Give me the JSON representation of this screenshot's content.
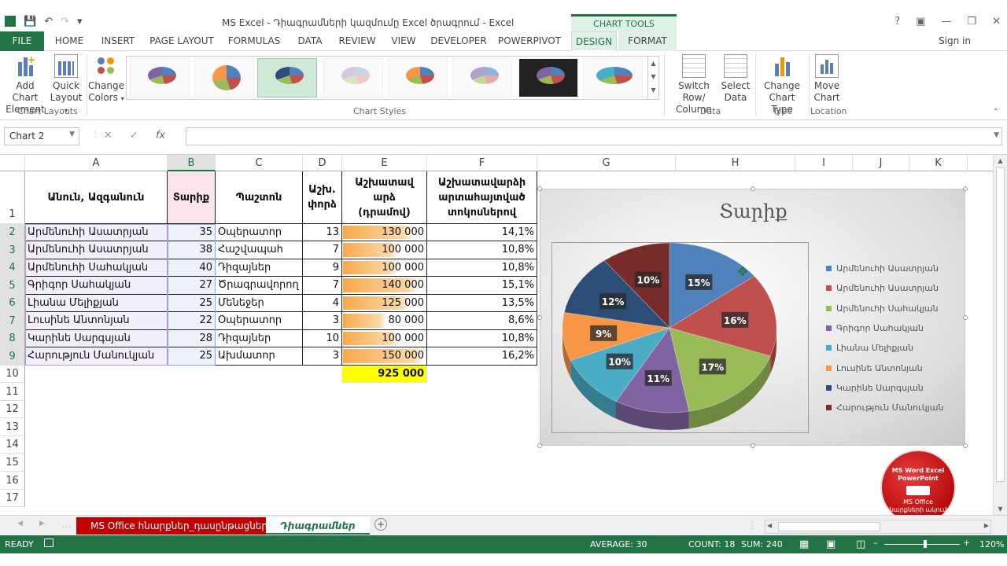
{
  "window": {
    "title": "MS Excel - Դիագրամների կազմումը Excel ծրագրում - Excel",
    "context_group": "CHART TOOLS"
  },
  "tabs": [
    "FILE",
    "HOME",
    "INSERT",
    "PAGE LAYOUT",
    "FORMULAS",
    "DATA",
    "REVIEW",
    "VIEW",
    "DEVELOPER",
    "POWERPIVOT",
    "DESIGN",
    "FORMAT"
  ],
  "signin": "Sign in",
  "ribbon": {
    "add_chart_element": "Add Chart",
    "add_chart_element2": "Element",
    "quick_layout": "Quick",
    "quick_layout2": "Layout",
    "change_colors": "Change",
    "change_colors2": "Colors",
    "chart_layouts_label": "Chart Layouts",
    "chart_styles_label": "Chart Styles",
    "switch_row_col": "Switch Row/",
    "switch_row_col2": "Column",
    "select_data": "Select",
    "select_data2": "Data",
    "data_label": "Data",
    "change_chart_type": "Change",
    "change_chart_type2": "Chart Type",
    "type_label": "Type",
    "move_chart": "Move",
    "move_chart2": "Chart",
    "location_label": "Location"
  },
  "namebox": "Chart 2",
  "formula": "",
  "columns": [
    "A",
    "B",
    "C",
    "D",
    "E",
    "F",
    "G",
    "H",
    "I",
    "J",
    "K"
  ],
  "rows": [
    "1",
    "2",
    "3",
    "4",
    "5",
    "6",
    "7",
    "8",
    "9",
    "10",
    "11",
    "12",
    "13",
    "14",
    "15",
    "16",
    "17"
  ],
  "table": {
    "headers": {
      "name": "Անուն, Ազգանուն",
      "age": "Տարիք",
      "position": "Պաշտոն",
      "exp1": "Աշխ.",
      "exp2": "փորձ",
      "salary1": "Աշխատավ",
      "salary2": "արձ",
      "salary3": "(դրամով)",
      "pct1": "Աշխատավարձի",
      "pct2": "արտահայտված",
      "pct3": "տոկոսներով"
    },
    "rows": [
      {
        "name": "Արմենուհի Ասատրյան",
        "age": "35",
        "position": "Օպերատոր",
        "exp": "13",
        "salary": "130 000",
        "pct": "14,1%",
        "fill": 0.87
      },
      {
        "name": "Արմենուհի Ասատրյան",
        "age": "38",
        "position": "Հաշվապահ",
        "exp": "7",
        "salary": "100 000",
        "pct": "10,8%",
        "fill": 0.67
      },
      {
        "name": "Արմենուհի Սահակյան",
        "age": "40",
        "position": "Դիզայներ",
        "exp": "9",
        "salary": "100 000",
        "pct": "10,8%",
        "fill": 0.67
      },
      {
        "name": "Գրիգոր Սահակյան",
        "age": "27",
        "position": "Ծրագրավորող",
        "exp": "7",
        "salary": "140 000",
        "pct": "15,1%",
        "fill": 0.93
      },
      {
        "name": "Լիանա Մելիքյան",
        "age": "25",
        "position": "Մենեջեր",
        "exp": "4",
        "salary": "125 000",
        "pct": "13,5%",
        "fill": 0.83
      },
      {
        "name": "Լուսինե Անտոնյան",
        "age": "22",
        "position": "Օպերատոր",
        "exp": "3",
        "salary": "80 000",
        "pct": "8,6%",
        "fill": 0.53
      },
      {
        "name": "Կարինե Սարգսյան",
        "age": "28",
        "position": "Դիզայներ",
        "exp": "10",
        "salary": "100 000",
        "pct": "10,8%",
        "fill": 0.67
      },
      {
        "name": "Հարություն  Մանուկյան",
        "age": "25",
        "position": "Ախմատոր",
        "exp": "3",
        "salary": "150 000",
        "pct": "16,2%",
        "fill": 1.0
      }
    ],
    "total": "925 000"
  },
  "chart_data": {
    "type": "pie",
    "title": "Տարիք",
    "categories": [
      "Արմենուհի Ասատրյան",
      "Արմենուհի Ասատրյան",
      "Արմենուհի Սահակյան",
      "Գրիգոր Սահակյան",
      "Լիանա Մելիքյան",
      "Լուսինե Անտոնյան",
      "Կարինե Սարգսյան",
      "Հարություն  Մանուկյան"
    ],
    "values": [
      35,
      38,
      40,
      27,
      25,
      22,
      28,
      25
    ],
    "data_labels": [
      "15%",
      "16%",
      "17%",
      "11%",
      "10%",
      "9%",
      "12%",
      "10%"
    ],
    "colors": [
      "#4f81bd",
      "#c0504d",
      "#9bbb59",
      "#8064a2",
      "#4bacc6",
      "#f79646",
      "#2c4d75",
      "#772c2a"
    ],
    "legend_position": "right"
  },
  "sheets": [
    "MS Office հնարքներ_դասընթացներ",
    "Դիագրամներ"
  ],
  "status": {
    "ready": "READY",
    "average": "AVERAGE: 30",
    "count": "COUNT: 18",
    "sum": "SUM: 240",
    "zoom": "120%"
  },
  "logo": {
    "line1": "MS Word Excel",
    "line2": "PowerPoint",
    "line3": "MS Office",
    "line4": "հնարքների ակումբ"
  }
}
